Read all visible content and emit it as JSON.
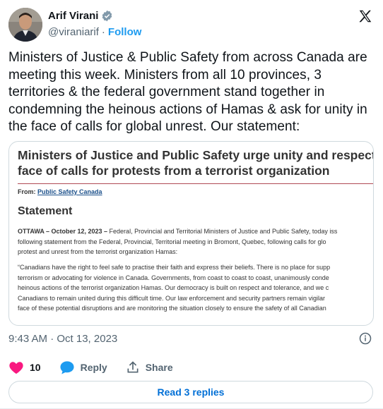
{
  "author": {
    "name": "Arif Virani",
    "handle": "@viraniarif",
    "separator": "·",
    "follow_label": "Follow"
  },
  "tweet": {
    "text": "Ministers of Justice & Public Safety from across Canada are meeting this week. Ministers from all 10 provinces, 3 territories & the federal government stand together in condemning the heinous actions of Hamas & ask for unity in the face of calls for global unrest. Our statement:"
  },
  "media": {
    "title_line1": "Ministers of Justice and Public Safety urge unity and respect in",
    "title_line2": "face of calls for protests from a terrorist organization",
    "from_label": "From:",
    "from_link": "Public Safety Canada",
    "heading": "Statement",
    "para1_lead": "OTTAWA – October 12, 2023 –",
    "para1_line1_rest": " Federal, Provincial and Territorial Ministers of Justice and Public Safety, today iss",
    "para1_line2": "following statement from the Federal, Provincial, Territorial meeting in Bromont, Quebec, following calls for glo",
    "para1_line3": "protest and unrest from the terrorist organization Hamas:",
    "para2_line1": "“Canadians have the right to feel safe to practise their faith and express their beliefs. There is no place for supp",
    "para2_line2": "terrorism or advocating for violence in Canada. Governments, from coast to coast to coast, unanimously conde",
    "para2_line3": "heinous actions of the terrorist organization Hamas. Our democracy is built on  respect and tolerance, and we c",
    "para2_line4": "Canadians to remain united during this difficult time. Our law enforcement and security partners remain vigilar",
    "para2_line5": "face of these potential disruptions and are monitoring the situation closely to ensure the safety of all Canadian"
  },
  "meta": {
    "timestamp": "9:43 AM · Oct 13, 2023"
  },
  "actions": {
    "like_count": "10",
    "reply_label": "Reply",
    "share_label": "Share",
    "read_replies_label": "Read 3 replies"
  },
  "colors": {
    "accent": "#1d9bf0",
    "like": "#f91880",
    "text_secondary": "#536471",
    "doc_rule": "#b04a55"
  },
  "icons": [
    "verified-badge-icon",
    "x-logo-icon",
    "info-icon",
    "heart-icon",
    "reply-bubble-icon",
    "share-upload-icon"
  ]
}
